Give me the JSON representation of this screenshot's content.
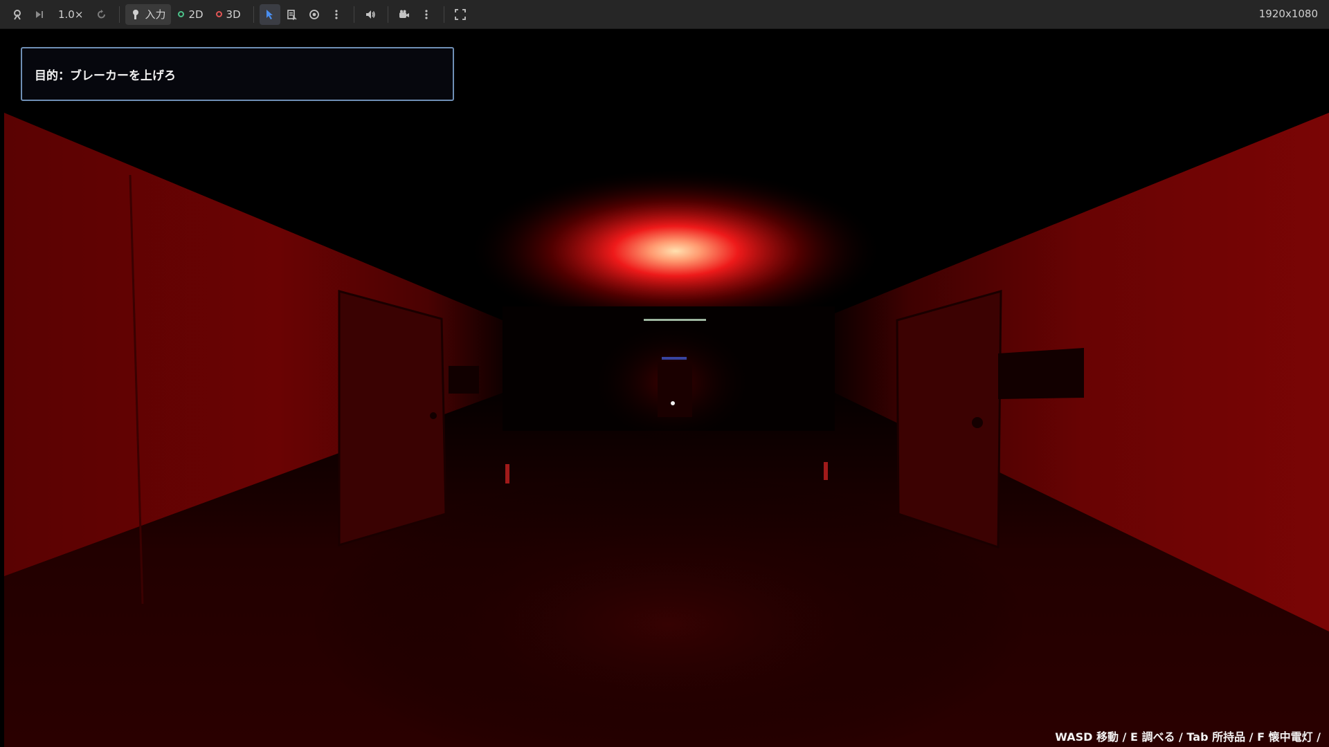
{
  "toolbar": {
    "speed_label": "1.0×",
    "input_label": "入力",
    "mode_2d_label": "2D",
    "mode_3d_label": "3D",
    "resolution": "1920x1080",
    "icons": [
      "remote-debug-icon",
      "step-frame-icon",
      "reset-icon",
      "input-icon",
      "select-cursor-icon",
      "list-select-icon",
      "visibility-icon",
      "more-options-icon",
      "audio-icon",
      "camera-override-icon",
      "more-options-icon",
      "fullscreen-icon"
    ],
    "colors": {
      "background": "#262626",
      "accent_2d": "#4cc28a",
      "accent_3d": "#e05555",
      "select_active": "#4a8ef0"
    }
  },
  "hud": {
    "objective_text": "目的：ブレーカーを上げろ",
    "controls_hint": "WASD 移動 / E 調べる / Tab 所持品 / F 懐中電灯 /"
  },
  "scene": {
    "description_colors": {
      "ambient_red": "#7a0000",
      "light_core": "#ffd7a0"
    }
  }
}
